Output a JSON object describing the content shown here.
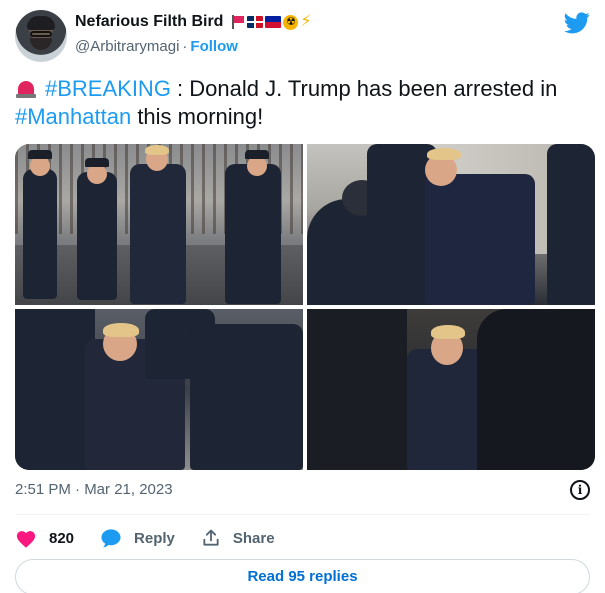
{
  "author": {
    "display_name": "Nefarious Filth Bird",
    "handle": "@Arbitrarymagi",
    "separator": "·",
    "follow_label": "Follow",
    "name_emojis": [
      "triangular-flag",
      "dominican-republic-flag",
      "haiti-flag",
      "radioactive",
      "high-voltage"
    ]
  },
  "tweet": {
    "prefix_emoji": "police-car-light",
    "hashtag_breaking": "#BREAKING",
    "text_part1": " : Donald J. Trump has been arrested in ",
    "hashtag_manhattan": "#Manhattan",
    "text_part2": " this morning!"
  },
  "media": {
    "images": [
      "police-officers-chasing-trump-on-street",
      "officers-tackling-trump-by-building",
      "trump-pushed-down-by-officers",
      "trump-surrounded-by-riot-police"
    ]
  },
  "meta": {
    "timestamp": "2:51 PM · Mar 21, 2023"
  },
  "actions": {
    "likes_count": "820",
    "reply_label": "Reply",
    "share_label": "Share",
    "read_replies_label": "Read 95 replies"
  },
  "colors": {
    "accent": "#1d9bf0",
    "like": "#f91880",
    "text_primary": "#0f1419",
    "text_secondary": "#536471",
    "link_button": "#006fd6"
  }
}
